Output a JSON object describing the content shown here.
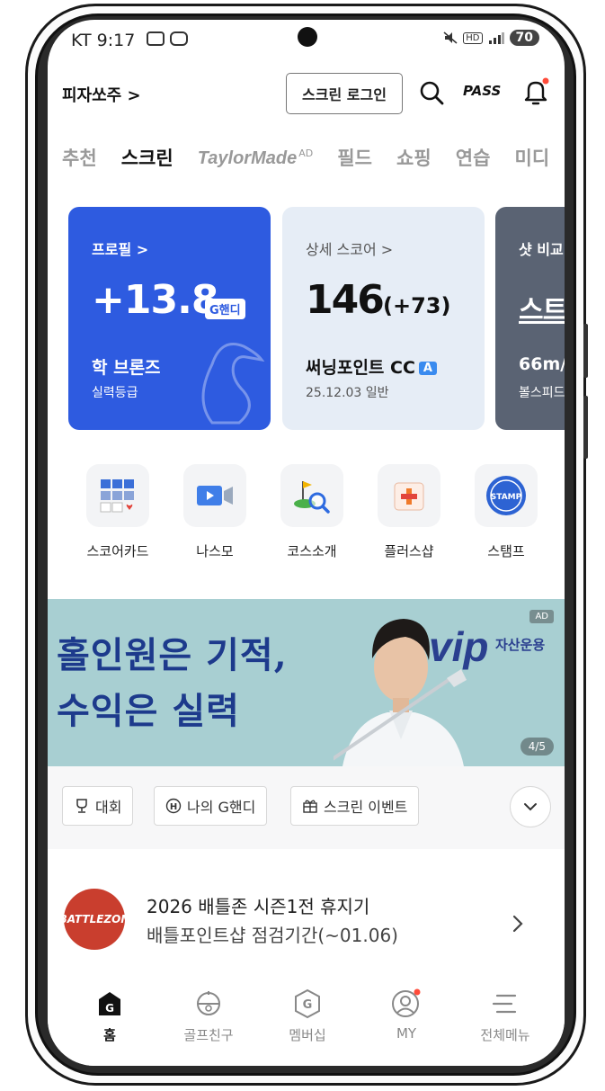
{
  "status_bar": {
    "time": "KT 9:17",
    "battery": "70"
  },
  "header": {
    "user_name": "피자쏘주 >",
    "login_button": "스크린 로그인",
    "pass_label": "PASS"
  },
  "tabs": [
    {
      "label": "추천"
    },
    {
      "label": "스크린"
    },
    {
      "label": "TaylorMade",
      "badge": "AD"
    },
    {
      "label": "필드"
    },
    {
      "label": "쇼핑"
    },
    {
      "label": "연습"
    },
    {
      "label": "미디"
    }
  ],
  "cards": {
    "profile": {
      "link": "프로필 >",
      "value": "+13.8",
      "chip": "G핸디",
      "grade": "학 브론즈",
      "grade_label": "실력등급"
    },
    "score": {
      "link": "상세 스코어 >",
      "score": "146",
      "delta": "(+73)",
      "course": "써닝포인트 CC",
      "course_badge": "A",
      "date": "25.12.03 일반"
    },
    "shot": {
      "link": "샷 비교",
      "big": "스트",
      "distance": "66m/",
      "sub": "볼스피드"
    }
  },
  "quick_menu": [
    {
      "label": "스코어카드",
      "icon": "scorecard-icon"
    },
    {
      "label": "나스모",
      "icon": "video-icon"
    },
    {
      "label": "코스소개",
      "icon": "course-search-icon"
    },
    {
      "label": "플러스샵",
      "icon": "plus-shop-icon"
    },
    {
      "label": "스탬프",
      "icon": "stamp-icon"
    }
  ],
  "stamp_text": "STAMP",
  "banner": {
    "line1": "홀인원은 기적,",
    "line2": "수익은 실력",
    "brand": "vip",
    "brand_sub": "자산운용",
    "ad": "AD",
    "page": "4/5"
  },
  "chips": {
    "tournament": "대회",
    "handicap": "나의 G핸디",
    "event": "스크린 이벤트"
  },
  "notice": {
    "logo_text": "BATTLEZON",
    "title": "2026 배틀존 시즌1전 휴지기",
    "subtitle": "배틀포인트샵 점검기간(~01.06)"
  },
  "bottom_nav": [
    {
      "label": "홈",
      "active": true
    },
    {
      "label": "골프친구"
    },
    {
      "label": "멤버십"
    },
    {
      "label": "MY"
    },
    {
      "label": "전체메뉴"
    }
  ],
  "colors": {
    "profile_card": "#2e5be0",
    "score_card": "#e6edf6",
    "banner_bg": "#a8cfd2",
    "banner_text": "#1d3a8c",
    "notification_dot": "#ff4b3a"
  }
}
